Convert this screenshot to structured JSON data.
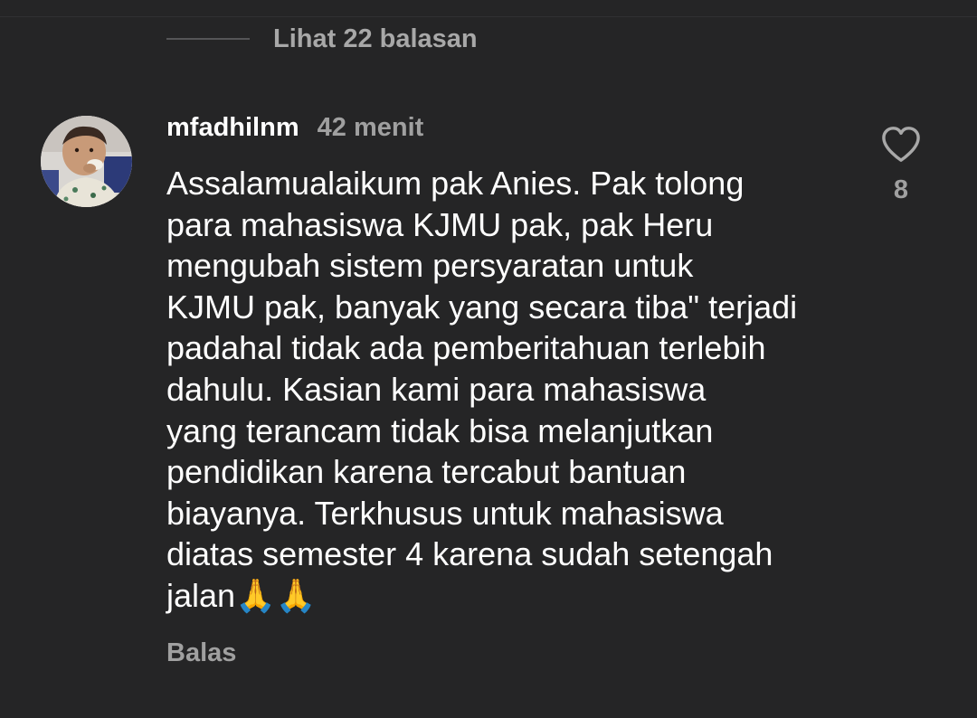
{
  "replies_toggle": {
    "label": "Lihat 22 balasan"
  },
  "comment": {
    "username": "mfadhilnm",
    "timestamp": "42 menit",
    "text": "Assalamualaikum pak Anies. Pak tolong\npara mahasiswa KJMU pak, pak Heru\nmengubah sistem persyaratan untuk\nKJMU pak, banyak yang secara tiba\" terjadi\npadahal tidak ada pemberitahuan terlebih\ndahulu. Kasian kami para mahasiswa\nyang terancam tidak bisa melanjutkan\npendidikan karena tercabut bantuan\nbiayanya. Terkhusus untuk mahasiswa\ndiatas semester 4 karena sudah setengah\njalan🙏🙏",
    "like_count": "8",
    "reply_label": "Balas",
    "avatar_icon": "user-avatar-photo",
    "like_icon": "heart-outline-icon"
  },
  "colors": {
    "background": "#252526",
    "primary_text": "#ffffff",
    "secondary_text": "#a0a0a0"
  }
}
